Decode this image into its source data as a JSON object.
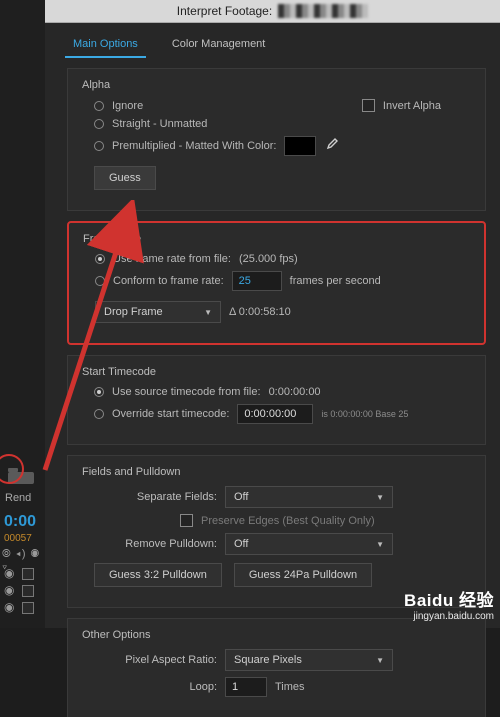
{
  "title": "Interpret Footage:",
  "tabs": {
    "main": "Main Options",
    "color": "Color Management"
  },
  "alpha": {
    "title": "Alpha",
    "ignore": "Ignore",
    "invert": "Invert Alpha",
    "straight": "Straight - Unmatted",
    "premult": "Premultiplied - Matted With Color:",
    "guess": "Guess"
  },
  "frame_rate": {
    "title": "Frame Rate",
    "use_file": "Use frame rate from file:",
    "use_file_value": "(25.000 fps)",
    "conform": "Conform to frame rate:",
    "conform_value": "25",
    "conform_unit": "frames per second",
    "drop_frame": "Drop Frame",
    "delta_label": "Δ 0:00:58:10"
  },
  "start_tc": {
    "title": "Start Timecode",
    "use_source": "Use source timecode from file:",
    "use_source_value": "0:00:00:00",
    "override": "Override start timecode:",
    "override_value": "0:00:00:00",
    "note": "is 0:00:00:00  Base 25"
  },
  "fields": {
    "title": "Fields and Pulldown",
    "separate": "Separate Fields:",
    "separate_value": "Off",
    "preserve": "Preserve Edges (Best Quality Only)",
    "remove": "Remove Pulldown:",
    "remove_value": "Off",
    "guess32": "Guess 3:2 Pulldown",
    "guess24": "Guess 24Pa Pulldown"
  },
  "other": {
    "title": "Other Options",
    "par": "Pixel Aspect Ratio:",
    "par_value": "Square Pixels",
    "loop": "Loop:",
    "loop_value": "1",
    "loop_unit": "Times"
  },
  "left": {
    "rend": "Rend",
    "timecode": "0:00",
    "framecount": "00057",
    "speaker_row": "⦾ ◂) ◉ ▿"
  },
  "watermark": {
    "brand": "Baidu 经验",
    "url": "jingyan.baidu.com"
  }
}
